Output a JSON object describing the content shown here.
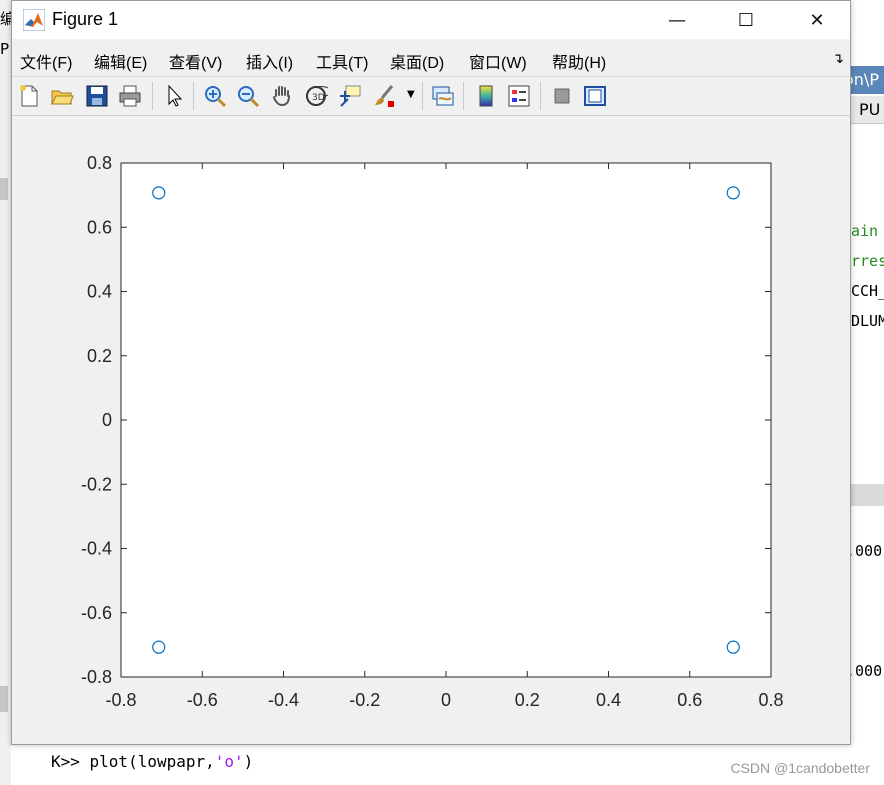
{
  "window": {
    "title": "Figure 1",
    "minimize": "—",
    "maximize": "☐",
    "close": "✕"
  },
  "menu": [
    {
      "label": "文件(F)"
    },
    {
      "label": "编辑(E)"
    },
    {
      "label": "查看(V)"
    },
    {
      "label": "插入(I)"
    },
    {
      "label": "工具(T)"
    },
    {
      "label": "桌面(D)"
    },
    {
      "label": "窗口(W)"
    },
    {
      "label": "帮助(H)"
    }
  ],
  "toolbar": {
    "icons": [
      "new-figure-icon",
      "open-file-icon",
      "save-icon",
      "print-icon",
      "pointer-icon",
      "zoom-in-icon",
      "zoom-out-icon",
      "pan-hand-icon",
      "rotate-3d-icon",
      "data-cursor-icon",
      "brush-icon",
      "link-plot-icon",
      "colorbar-icon",
      "legend-icon",
      "hide-plot-tools-icon",
      "show-plot-tools-icon"
    ]
  },
  "chart_data": {
    "type": "scatter",
    "marker": "o",
    "marker_color": "#0072bd",
    "x": [
      -0.7071,
      0.7071,
      -0.7071,
      0.7071
    ],
    "y": [
      0.7071,
      0.7071,
      -0.7071,
      -0.7071
    ],
    "xlim": [
      -0.8,
      0.8
    ],
    "ylim": [
      -0.8,
      0.8
    ],
    "xticks": [
      "-0.8",
      "-0.6",
      "-0.4",
      "-0.2",
      "0",
      "0.2",
      "0.4",
      "0.6",
      "0.8"
    ],
    "yticks": [
      "0.8",
      "0.6",
      "0.4",
      "0.2",
      "0",
      "-0.2",
      "-0.4",
      "-0.6",
      "-0.8"
    ],
    "grid": false
  },
  "background": {
    "tab_text": "on\\P",
    "tab2_text": "PU",
    "left_marks": [
      "编",
      "P"
    ],
    "code_lines": [
      {
        "text": "ain",
        "color": "#228b22"
      },
      {
        "text": "rres",
        "color": "#228b22"
      },
      {
        "text": "CCH_",
        "color": "#000000"
      },
      {
        "text": "DLUM",
        "color": "#000000"
      },
      {
        "text": ".000",
        "color": "#000000"
      },
      {
        "text": ".000",
        "color": "#000000"
      }
    ],
    "command": {
      "prefix": "K>> plot(lowpapr,",
      "arg": "'o'",
      "suffix": ")"
    },
    "watermark": "CSDN @1candobetter"
  }
}
